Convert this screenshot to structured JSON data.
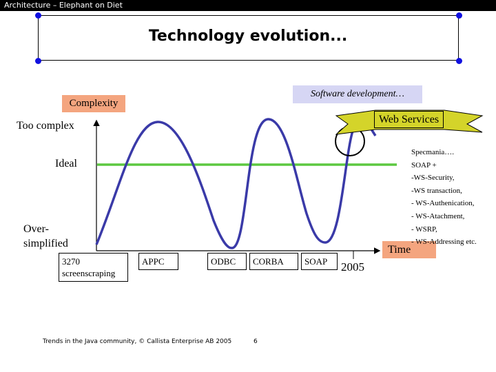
{
  "header": "Architecture – Elephant on Diet",
  "title": "Technology evolution...",
  "labels": {
    "complexity": "Complexity",
    "software_dev": "Software development…",
    "web_services": "Web Services",
    "too_complex": "Too complex",
    "ideal": "Ideal",
    "oversimplified_1": "Over-",
    "oversimplified_2": "simplified",
    "time": "Time",
    "year": "2005"
  },
  "technologies": [
    {
      "line1": "3270",
      "line2": "screenscraping"
    },
    {
      "line1": "APPC"
    },
    {
      "line1": "ODBC"
    },
    {
      "line1": "CORBA"
    },
    {
      "line1": "SOAP"
    }
  ],
  "spec_list": [
    "Specmania….",
    "SOAP +",
    "-WS-Security,",
    "-WS transaction,",
    "- WS-Authenication,",
    "- WS-Atachment,",
    "- WSRP,",
    "- WS-Addressing etc."
  ],
  "footer": {
    "text": "Trends in the Java community, © Callista Enterprise AB 2005",
    "page": "6"
  },
  "colors": {
    "curve": "#3a3aa8",
    "ideal_line": "#5cc840",
    "banner": "#d4d42a",
    "label_bg": "#f4a57f",
    "subtitle_bg": "#d6d6f4"
  }
}
